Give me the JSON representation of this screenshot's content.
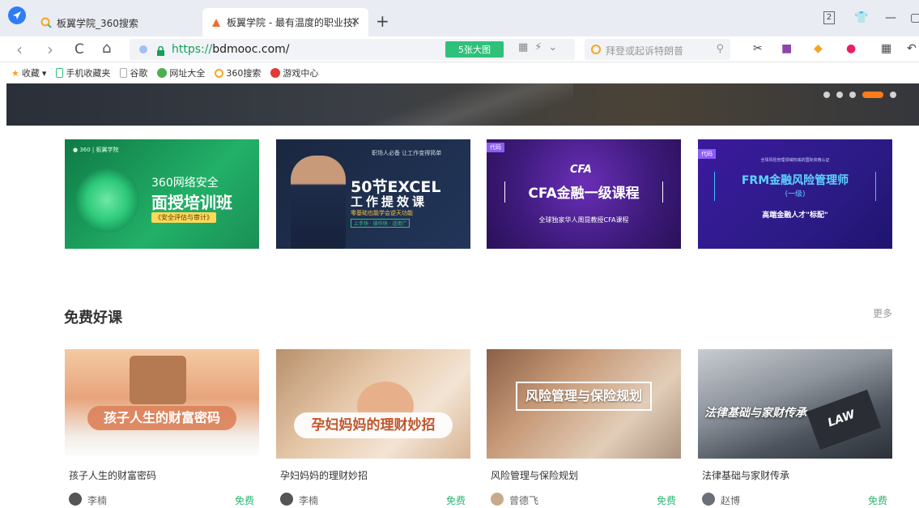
{
  "browser": {
    "tabs": [
      {
        "title": "板翼学院_360搜索",
        "active": false
      },
      {
        "title": "板翼学院 - 最有温度的职业技能",
        "active": true
      }
    ],
    "new_tab": "+",
    "tab_count": "2",
    "url_scheme": "https://",
    "url_host": "bdmooc.com/",
    "bigpic_label": "5张大图",
    "search_placeholder": "拜登或起诉特朗普",
    "nav": {
      "back": "‹",
      "forward": "›",
      "reload": "C",
      "home": "⌂"
    }
  },
  "bookmarks": [
    {
      "label": "收藏",
      "icon": "star-icon",
      "color": "#f5a623"
    },
    {
      "label": "手机收藏夹",
      "icon": "phone-icon",
      "color": "#2fc07a"
    },
    {
      "label": "谷歌",
      "icon": "page-icon",
      "color": "#bbbbbb"
    },
    {
      "label": "网址大全",
      "icon": "globe-icon",
      "color": "#4caf50"
    },
    {
      "label": "360搜索",
      "icon": "search360-icon",
      "color": "#f5a623"
    },
    {
      "label": "游戏中心",
      "icon": "game-icon",
      "color": "#e53935"
    }
  ],
  "hero": {
    "slide_count": 5,
    "active_slide": 4
  },
  "promos": [
    {
      "name": "promo-security",
      "line1": "360网络安全",
      "line2": "面授培训班",
      "line3": "《安全评估与审计》",
      "bg": "#1d9a5a"
    },
    {
      "name": "promo-excel",
      "top": "职场人必备 让工作变得简单",
      "line1": "50节EXCEL",
      "line2": "工作提效课",
      "line3": "零基础也能学会逆天功能",
      "line4": "上手快 · 操作快 · 适用广",
      "bg": "#1b2a44"
    },
    {
      "name": "promo-cfa",
      "tag": "代码",
      "logo": "CFA",
      "line1": "CFA金融一级课程",
      "line2": "全球独家华人周昆教授CFA课程",
      "bg": "#3d1a7a"
    },
    {
      "name": "promo-frm",
      "tag": "代码",
      "top": "全球风险管理领域权威的国际资格认证",
      "line1": "FRM金融风险管理师",
      "line2": "(一级)",
      "line3": "高端金融人才\"标配\"",
      "bg": "#2c1b86"
    }
  ],
  "section": {
    "title": "免费好课",
    "more": "更多"
  },
  "courses": [
    {
      "image_title": "孩子人生的财富密码",
      "name": "孩子人生的财富密码",
      "teacher": "李楠",
      "price": "免费"
    },
    {
      "image_title": "孕妇妈妈的理财妙招",
      "name": "孕妇妈妈的理财妙招",
      "teacher": "李楠",
      "price": "免费"
    },
    {
      "image_title": "风险管理与保险规划",
      "name": "风险管理与保险规划",
      "teacher": "曾德飞",
      "price": "免费"
    },
    {
      "image_title": "法律基础与家财传承",
      "name": "法律基础与家财传承",
      "teacher": "赵博",
      "price": "免费"
    }
  ],
  "colors": {
    "accent_green": "#2bb673",
    "dot_active": "#ff7a1a",
    "url_green": "#14a05a"
  }
}
